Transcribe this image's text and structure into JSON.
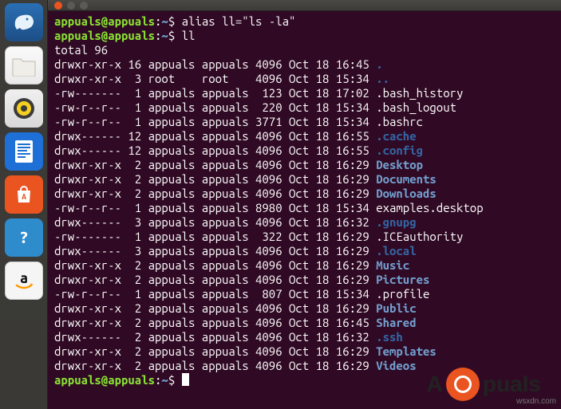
{
  "prompt": {
    "user": "appuals@appuals",
    "sep": ":",
    "path": "~",
    "dollar": "$"
  },
  "commands": {
    "alias": "alias ll=\"ls -la\"",
    "ll": "ll"
  },
  "listing": {
    "total_line": "total 96",
    "rows": [
      {
        "perm": "drwxr-xr-x",
        "n": "16",
        "owner": "appuals",
        "group": "appuals",
        "size": "4096",
        "date": "Oct 18 16:45",
        "name": ".",
        "cls": "dblue"
      },
      {
        "perm": "drwxr-xr-x",
        "n": " 3",
        "owner": "root   ",
        "group": "root   ",
        "size": "4096",
        "date": "Oct 18 15:34",
        "name": "..",
        "cls": "dblue"
      },
      {
        "perm": "-rw-------",
        "n": " 1",
        "owner": "appuals",
        "group": "appuals",
        "size": " 123",
        "date": "Oct 18 17:02",
        "name": ".bash_history",
        "cls": "white"
      },
      {
        "perm": "-rw-r--r--",
        "n": " 1",
        "owner": "appuals",
        "group": "appuals",
        "size": " 220",
        "date": "Oct 18 15:34",
        "name": ".bash_logout",
        "cls": "white"
      },
      {
        "perm": "-rw-r--r--",
        "n": " 1",
        "owner": "appuals",
        "group": "appuals",
        "size": "3771",
        "date": "Oct 18 15:34",
        "name": ".bashrc",
        "cls": "white"
      },
      {
        "perm": "drwx------",
        "n": "12",
        "owner": "appuals",
        "group": "appuals",
        "size": "4096",
        "date": "Oct 18 16:55",
        "name": ".cache",
        "cls": "dblue"
      },
      {
        "perm": "drwx------",
        "n": "12",
        "owner": "appuals",
        "group": "appuals",
        "size": "4096",
        "date": "Oct 18 16:55",
        "name": ".config",
        "cls": "dblue"
      },
      {
        "perm": "drwxr-xr-x",
        "n": " 2",
        "owner": "appuals",
        "group": "appuals",
        "size": "4096",
        "date": "Oct 18 16:29",
        "name": "Desktop",
        "cls": "blue"
      },
      {
        "perm": "drwxr-xr-x",
        "n": " 2",
        "owner": "appuals",
        "group": "appuals",
        "size": "4096",
        "date": "Oct 18 16:29",
        "name": "Documents",
        "cls": "blue"
      },
      {
        "perm": "drwxr-xr-x",
        "n": " 2",
        "owner": "appuals",
        "group": "appuals",
        "size": "4096",
        "date": "Oct 18 16:29",
        "name": "Downloads",
        "cls": "blue"
      },
      {
        "perm": "-rw-r--r--",
        "n": " 1",
        "owner": "appuals",
        "group": "appuals",
        "size": "8980",
        "date": "Oct 18 15:34",
        "name": "examples.desktop",
        "cls": "white"
      },
      {
        "perm": "drwx------",
        "n": " 3",
        "owner": "appuals",
        "group": "appuals",
        "size": "4096",
        "date": "Oct 18 16:32",
        "name": ".gnupg",
        "cls": "dblue"
      },
      {
        "perm": "-rw-------",
        "n": " 1",
        "owner": "appuals",
        "group": "appuals",
        "size": " 322",
        "date": "Oct 18 16:29",
        "name": ".ICEauthority",
        "cls": "white"
      },
      {
        "perm": "drwx------",
        "n": " 3",
        "owner": "appuals",
        "group": "appuals",
        "size": "4096",
        "date": "Oct 18 16:29",
        "name": ".local",
        "cls": "dblue"
      },
      {
        "perm": "drwxr-xr-x",
        "n": " 2",
        "owner": "appuals",
        "group": "appuals",
        "size": "4096",
        "date": "Oct 18 16:29",
        "name": "Music",
        "cls": "blue"
      },
      {
        "perm": "drwxr-xr-x",
        "n": " 2",
        "owner": "appuals",
        "group": "appuals",
        "size": "4096",
        "date": "Oct 18 16:29",
        "name": "Pictures",
        "cls": "blue"
      },
      {
        "perm": "-rw-r--r--",
        "n": " 1",
        "owner": "appuals",
        "group": "appuals",
        "size": " 807",
        "date": "Oct 18 15:34",
        "name": ".profile",
        "cls": "white"
      },
      {
        "perm": "drwxr-xr-x",
        "n": " 2",
        "owner": "appuals",
        "group": "appuals",
        "size": "4096",
        "date": "Oct 18 16:29",
        "name": "Public",
        "cls": "blue"
      },
      {
        "perm": "drwxr-xr-x",
        "n": " 2",
        "owner": "appuals",
        "group": "appuals",
        "size": "4096",
        "date": "Oct 18 16:45",
        "name": "Shared",
        "cls": "blue"
      },
      {
        "perm": "drwx------",
        "n": " 2",
        "owner": "appuals",
        "group": "appuals",
        "size": "4096",
        "date": "Oct 18 16:32",
        "name": ".ssh",
        "cls": "dblue"
      },
      {
        "perm": "drwxr-xr-x",
        "n": " 2",
        "owner": "appuals",
        "group": "appuals",
        "size": "4096",
        "date": "Oct 18 16:29",
        "name": "Templates",
        "cls": "blue"
      },
      {
        "perm": "drwxr-xr-x",
        "n": " 2",
        "owner": "appuals",
        "group": "appuals",
        "size": "4096",
        "date": "Oct 18 16:29",
        "name": "Videos",
        "cls": "blue"
      }
    ]
  },
  "brand": {
    "left": "A",
    "right": "puals"
  },
  "watermark": "wsxdn.com"
}
